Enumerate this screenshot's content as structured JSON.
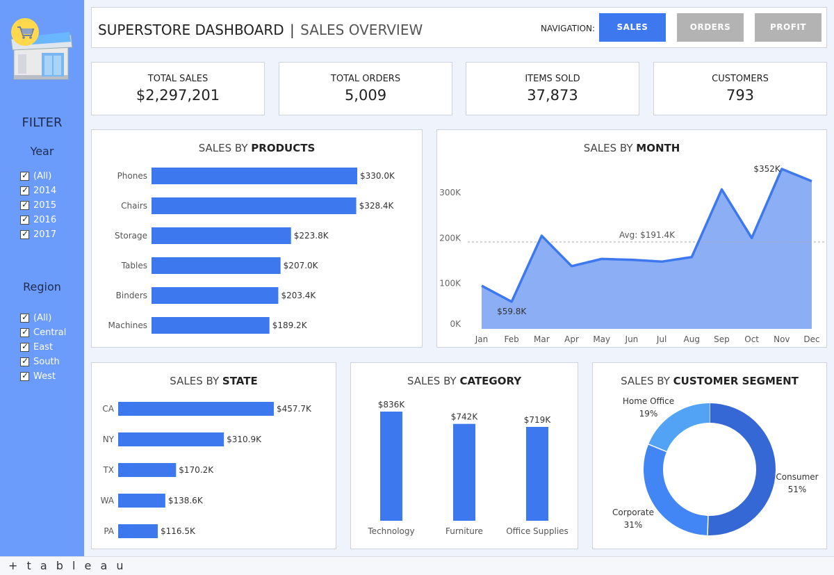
{
  "sidebar": {
    "filter_title": "FILTER",
    "year_title": "Year",
    "years": [
      "(All)",
      "2014",
      "2015",
      "2016",
      "2017"
    ],
    "region_title": "Region",
    "regions": [
      "(All)",
      "Central",
      "East",
      "South",
      "West"
    ]
  },
  "header": {
    "title": "SUPERSTORE DASHBOARD",
    "separator": "|",
    "subtitle": "SALES OVERVIEW",
    "nav_label": "NAVIGATION:",
    "buttons": [
      {
        "label": "SALES",
        "color": "#3d78ef"
      },
      {
        "label": "ORDERS",
        "color": "#b3b3b3"
      },
      {
        "label": "PROFIT",
        "color": "#b3b3b3"
      }
    ]
  },
  "kpis": [
    {
      "label": "TOTAL SALES",
      "value": "$2,297,201"
    },
    {
      "label": "TOTAL ORDERS",
      "value": "5,009"
    },
    {
      "label": "ITEMS SOLD",
      "value": "37,873"
    },
    {
      "label": "CUSTOMERS",
      "value": "793"
    }
  ],
  "colors": {
    "accent": "#3d78ef",
    "sidebar": "#6b9cfb",
    "area_fill": "#8caef5",
    "line": "#3d78ef",
    "donut": [
      "#3568d4",
      "#4285f4",
      "#52a3f5"
    ]
  },
  "charts": {
    "products": {
      "title_plain": "SALES BY ",
      "title_bold": "PRODUCTS"
    },
    "month": {
      "title_plain": "SALES BY ",
      "title_bold": "MONTH"
    },
    "state": {
      "title_plain": "SALES BY ",
      "title_bold": "STATE"
    },
    "category": {
      "title_plain": "SALES BY ",
      "title_bold": "CATEGORY"
    },
    "segment": {
      "title_plain": "SALES BY ",
      "title_bold": "CUSTOMER SEGMENT"
    }
  },
  "footer": {
    "brand": "+ t a b l e a u"
  },
  "chart_data": [
    {
      "type": "bar",
      "orientation": "horizontal",
      "title": "SALES BY PRODUCTS",
      "categories": [
        "Phones",
        "Chairs",
        "Storage",
        "Tables",
        "Binders",
        "Machines"
      ],
      "values": [
        330.0,
        328.4,
        223.8,
        207.0,
        203.4,
        189.2
      ],
      "labels": [
        "$330.0K",
        "$328.4K",
        "$223.8K",
        "$207.0K",
        "$203.4K",
        "$189.2K"
      ],
      "unit": "$K"
    },
    {
      "type": "area",
      "title": "SALES BY MONTH",
      "categories": [
        "Jan",
        "Feb",
        "Mar",
        "Apr",
        "May",
        "Jun",
        "Jul",
        "Aug",
        "Sep",
        "Oct",
        "Nov",
        "Dec"
      ],
      "values": [
        95,
        59.8,
        205,
        138,
        154,
        152,
        148,
        158,
        307,
        200,
        352,
        325
      ],
      "ylim": [
        0,
        352
      ],
      "yticks": [
        {
          "v": 0,
          "label": "0K"
        },
        {
          "v": 100,
          "label": "100K"
        },
        {
          "v": 200,
          "label": "200K"
        },
        {
          "v": 300,
          "label": "300K"
        }
      ],
      "average": 191.4,
      "average_label": "Avg: $191.4K",
      "max_label": "$352K",
      "min_label": "$59.8K",
      "unit": "$K"
    },
    {
      "type": "bar",
      "orientation": "horizontal",
      "title": "SALES BY STATE",
      "categories": [
        "CA",
        "NY",
        "TX",
        "WA",
        "PA"
      ],
      "values": [
        457.7,
        310.9,
        170.2,
        138.6,
        116.5
      ],
      "labels": [
        "$457.7K",
        "$310.9K",
        "$170.2K",
        "$138.6K",
        "$116.5K"
      ],
      "unit": "$K"
    },
    {
      "type": "bar",
      "orientation": "vertical",
      "title": "SALES BY CATEGORY",
      "categories": [
        "Technology",
        "Furniture",
        "Office Supplies"
      ],
      "values": [
        836,
        742,
        719
      ],
      "labels": [
        "$836K",
        "$742K",
        "$719K"
      ],
      "unit": "$K"
    },
    {
      "type": "pie",
      "variant": "donut",
      "title": "SALES BY CUSTOMER SEGMENT",
      "categories": [
        "Consumer",
        "Corporate",
        "Home Office"
      ],
      "values": [
        51,
        31,
        19
      ],
      "labels": [
        "51%",
        "31%",
        "19%"
      ],
      "unit": "%"
    }
  ]
}
